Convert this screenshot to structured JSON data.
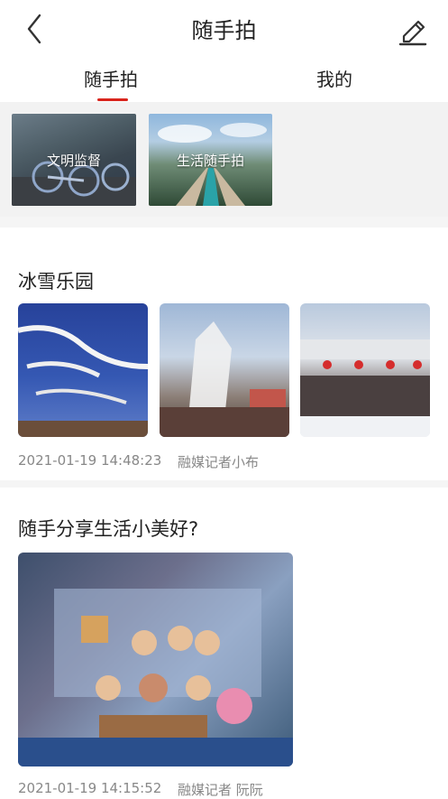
{
  "header": {
    "title": "随手拍",
    "back_icon": "chevron-left-icon",
    "edit_icon": "pencil-icon"
  },
  "tabs": [
    {
      "label": "随手拍",
      "active": true
    },
    {
      "label": "我的",
      "active": false
    }
  ],
  "categories": [
    {
      "label": "文明监督"
    },
    {
      "label": "生活随手拍"
    }
  ],
  "posts": [
    {
      "title": "冰雪乐园",
      "time": "2021-01-19 14:48:23",
      "author": "融媒记者小布",
      "image_count": 3
    },
    {
      "title": "随手分享生活小美好?",
      "time": "2021-01-19 14:15:52",
      "author": "融媒记者 阮阮",
      "image_count": 1
    }
  ],
  "colors": {
    "accent": "#d9251d",
    "muted_text": "#888888",
    "divider": "#f2f2f2"
  }
}
